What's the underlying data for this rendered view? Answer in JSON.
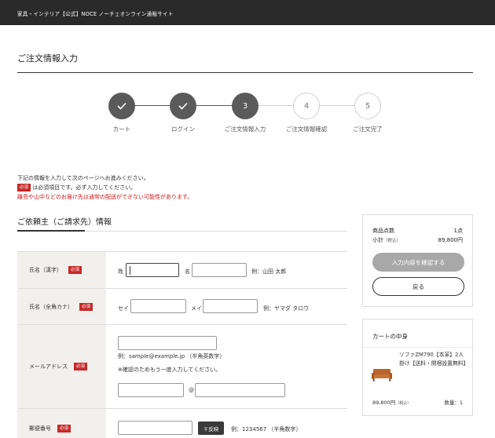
{
  "header": {
    "site_title": "家具・インテリア【公式】NOCE ノーチェオンライン通販サイト"
  },
  "page_title": "ご注文情報入力",
  "steps": [
    {
      "number": "",
      "label": "カート",
      "state": "done"
    },
    {
      "number": "",
      "label": "ログイン",
      "state": "done"
    },
    {
      "number": "3",
      "label": "ご注文情報入力",
      "state": "current"
    },
    {
      "number": "4",
      "label": "ご注文情報確認",
      "state": "todo"
    },
    {
      "number": "5",
      "label": "ご注文完了",
      "state": "todo"
    }
  ],
  "notice": {
    "line1": "下記の情報を入力して次のページへお進みください。",
    "required_badge": "必須",
    "line2": "は必須項目です。必ず入力してください。",
    "line3": "離島や山中などのお届け先は通常の配送ができない可能性があります。"
  },
  "section_title": "ご依頼主（ご請求先）情報",
  "form": {
    "required_badge": "必須",
    "name_kanji": {
      "label": "氏名（漢字）",
      "sei_label": "姓",
      "mei_label": "名",
      "example": "例：山田 太郎",
      "sei_value": "",
      "mei_value": ""
    },
    "name_kana": {
      "label": "氏名（全角カナ）",
      "sei_label": "セイ",
      "mei_label": "メイ",
      "example": "例：ヤマダ タロウ",
      "sei_value": "",
      "mei_value": ""
    },
    "email": {
      "label": "メールアドレス",
      "example": "例：sample@example.jp （半角英数字）",
      "confirm_note": "※確認のためもう一度入力してください。",
      "at": "@",
      "value": "",
      "confirm_local": "",
      "confirm_domain": ""
    },
    "postal": {
      "label": "郵便番号",
      "button": "〒反映",
      "example": "例：1234567 （半角数字）",
      "value": ""
    }
  },
  "summary": {
    "count_label": "商品点数",
    "count_value": "1点",
    "subtotal_label": "小計",
    "tax_label": "（税込）",
    "subtotal_value": "89,800円",
    "confirm_button": "入力内容を確認する",
    "back_button": "戻る"
  },
  "cart": {
    "title": "カートの中身",
    "item_name": "ソファZM790【本革】2人掛け【送料・開梱設置無料】",
    "price": "89,800円",
    "tax_label": "（税込）",
    "qty": "数量：1"
  },
  "colors": {
    "required": "#c62828",
    "step_active": "#5a5a5a",
    "header_bg": "#2a2a2a",
    "label_bg": "#f2f0ec",
    "notice_red": "#d01818"
  }
}
